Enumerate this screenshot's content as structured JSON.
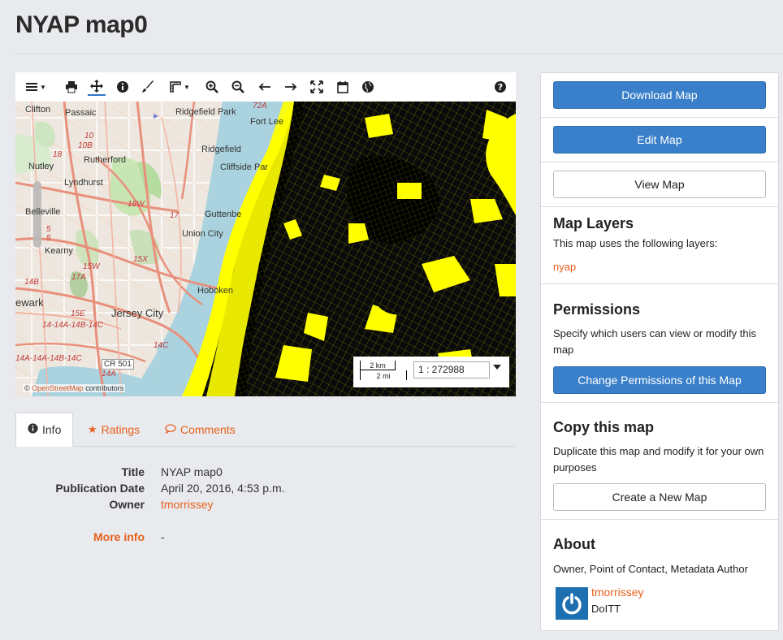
{
  "page": {
    "title": "NYAP map0"
  },
  "toolbar": {
    "items": [
      "menu-icon",
      "print-icon",
      "pan-icon",
      "info-icon",
      "paint-brush-icon",
      "measure-icon",
      "zoom-in-icon",
      "zoom-out-icon",
      "arrow-left-icon",
      "arrow-right-icon",
      "fullscreen-icon",
      "calendar-icon",
      "globe-icon",
      "help-icon"
    ]
  },
  "map": {
    "place_labels": [
      "Clifton",
      "Passaic",
      "Ridgefield Park",
      "Fort Lee",
      "Rutherford",
      "Ridgefield",
      "Cliffside Par",
      "Nutley",
      "Lyndhurst",
      "Guttenbe",
      "Belleville",
      "Union City",
      "Kearny",
      "Hoboken",
      "ewark",
      "Jersey City"
    ],
    "road_labels": [
      "72A",
      "10",
      "10B",
      "18",
      "16W",
      "17",
      "15X",
      "15W",
      "17A",
      "14B",
      "15E",
      "14-14A-14B-14C",
      "14A-14A-14B-14C",
      "14C",
      "14A",
      "CR 501",
      "5",
      "5"
    ],
    "attribution_prefix": "©",
    "attribution_link": "OpenStreetMap",
    "attribution_suffix": "contributors",
    "scale_km": "2 km",
    "scale_mi": "2 mi",
    "scale_ratio": "1 : 272988",
    "layer_color": "#ffff00"
  },
  "tabs": [
    {
      "label": "Info",
      "icon": "info-circle-icon"
    },
    {
      "label": "Ratings",
      "icon": "star-icon"
    },
    {
      "label": "Comments",
      "icon": "comment-icon"
    }
  ],
  "info": {
    "title_key": "Title",
    "title_val": "NYAP map0",
    "date_key": "Publication Date",
    "date_val": "April 20, 2016, 4:53 p.m.",
    "owner_key": "Owner",
    "owner_val": "tmorrissey",
    "more_key": "More info",
    "more_val": "-"
  },
  "sidebar": {
    "download_label": "Download Map",
    "edit_label": "Edit Map",
    "view_label": "View Map",
    "layers_heading": "Map Layers",
    "layers_text": "This map uses the following layers:",
    "layer_name": "nyap",
    "permissions_heading": "Permissions",
    "permissions_text": "Specify which users can view or modify this map",
    "change_permissions_label": "Change Permissions of this Map",
    "copy_heading": "Copy this map",
    "copy_text": "Duplicate this map and modify it for your own purposes",
    "create_label": "Create a New Map",
    "about_heading": "About",
    "about_roles": "Owner, Point of Contact, Metadata Author",
    "owner_name": "tmorrissey",
    "owner_org": "DoITT"
  },
  "colors": {
    "primary": "#3a7fc9",
    "link": "#e8601c"
  }
}
